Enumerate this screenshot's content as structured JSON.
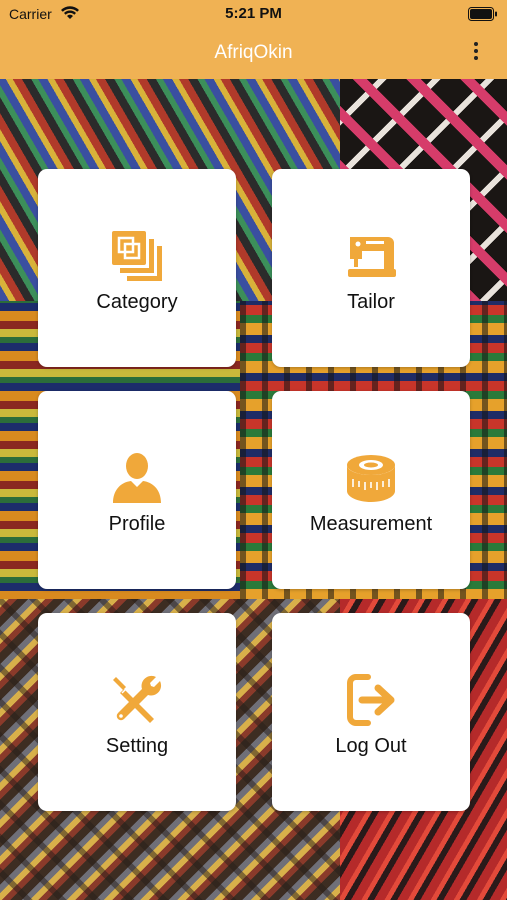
{
  "status_bar": {
    "carrier": "Carrier",
    "time": "5:21 PM"
  },
  "app": {
    "title": "AfriqOkin",
    "accent": "#f0b254"
  },
  "cards": [
    {
      "label": "Category",
      "icon": "category-icon"
    },
    {
      "label": "Tailor",
      "icon": "sewing-machine-icon"
    },
    {
      "label": "Profile",
      "icon": "profile-icon"
    },
    {
      "label": "Measurement",
      "icon": "measuring-tape-icon"
    },
    {
      "label": "Setting",
      "icon": "tools-icon"
    },
    {
      "label": "Log Out",
      "icon": "logout-icon"
    }
  ]
}
